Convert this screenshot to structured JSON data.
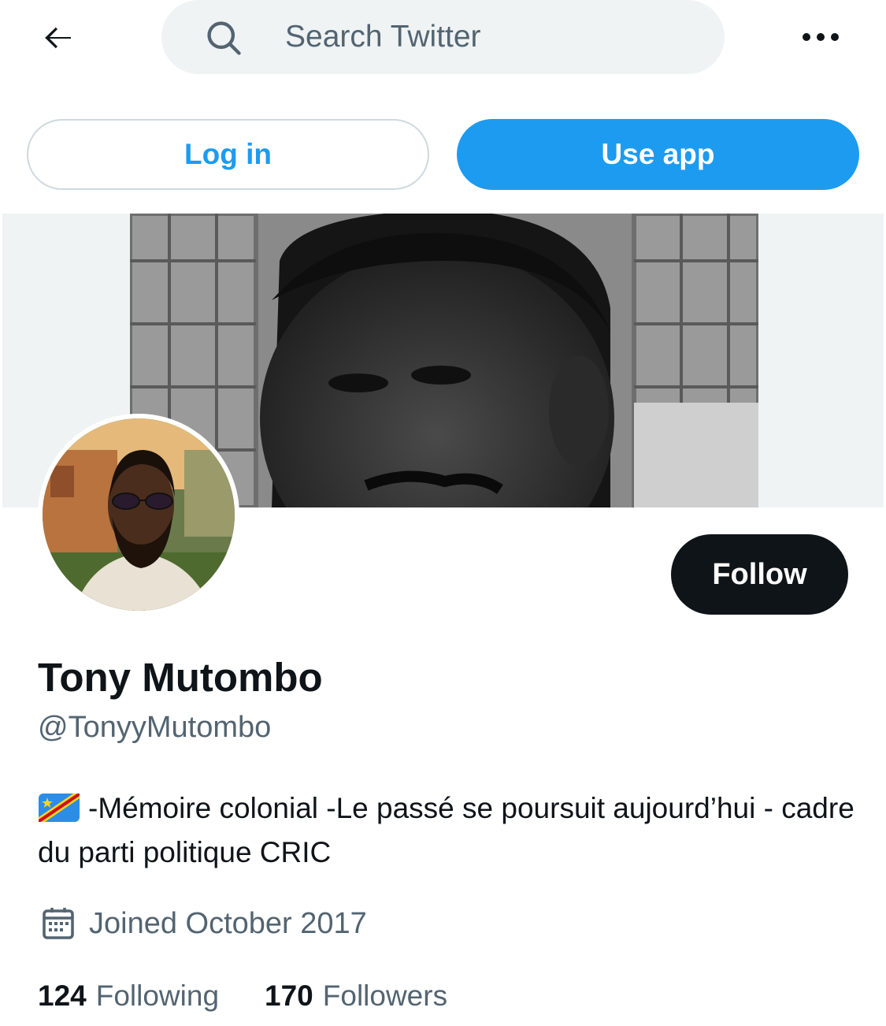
{
  "topbar": {
    "back_icon": "arrow-left-icon",
    "search": {
      "placeholder": "Search Twitter",
      "icon": "search-icon"
    },
    "more_icon": "more-horizontal-icon"
  },
  "actions": {
    "login_label": "Log in",
    "use_app_label": "Use app"
  },
  "profile": {
    "name": "Tony Mutombo",
    "handle": "@TonyyMutombo",
    "bio_flag_icon": "dr-congo-flag-emoji",
    "bio": "-Mémoire colonial -Le passé se poursuit aujourd’hui - cadre du parti politique CRIC",
    "joined_icon": "calendar-icon",
    "joined": "Joined October 2017",
    "follow_label": "Follow",
    "stats": {
      "following_count": "124",
      "following_label": "Following",
      "followers_count": "170",
      "followers_label": "Followers"
    }
  },
  "colors": {
    "accent": "#1d9bf0",
    "text_primary": "#0f1419",
    "text_secondary": "#536471",
    "follow_bg": "#0f1419",
    "search_bg": "#eff3f4"
  }
}
